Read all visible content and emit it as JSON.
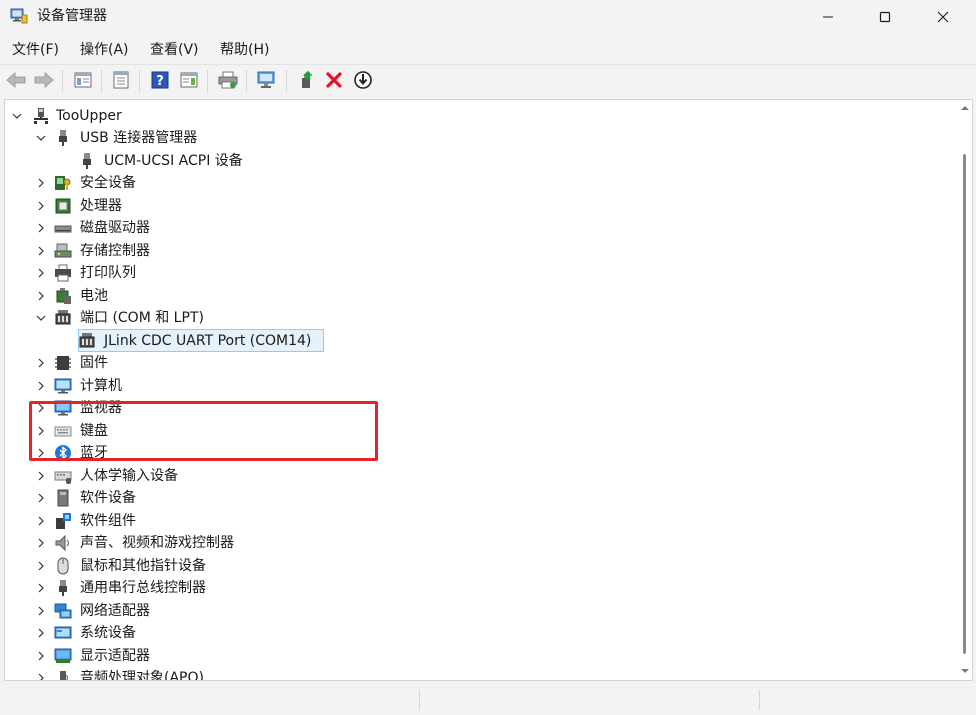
{
  "window": {
    "title": "设备管理器",
    "icon": "device-manager-icon",
    "controls": [
      "minimize-icon",
      "maximize-icon",
      "close-icon"
    ]
  },
  "menu": [
    {
      "label": "文件(F)"
    },
    {
      "label": "操作(A)"
    },
    {
      "label": "查看(V)"
    },
    {
      "label": "帮助(H)"
    }
  ],
  "toolbar": [
    {
      "icon": "back-arrow-icon"
    },
    {
      "icon": "forward-arrow-icon"
    },
    {
      "icon": "show-hide-console-tree-icon"
    },
    {
      "icon": "properties-icon"
    },
    {
      "icon": "help-icon"
    },
    {
      "icon": "action-pane-icon"
    },
    {
      "icon": "print-icon"
    },
    {
      "icon": "scan-hardware-icon"
    },
    {
      "icon": "update-driver-icon"
    },
    {
      "icon": "uninstall-device-icon"
    },
    {
      "icon": "disable-device-icon"
    }
  ],
  "tree": {
    "root": {
      "label": "TooUpper",
      "expanded": true,
      "icon": "computer-icon"
    },
    "items": [
      {
        "label": "USB 连接器管理器",
        "expanded": true,
        "level": 1,
        "icon": "usb-connector-icon"
      },
      {
        "label": "UCM-UCSI ACPI 设备",
        "level": 2,
        "icon": "usb-connector-icon"
      },
      {
        "label": "安全设备",
        "expanded": false,
        "level": 1,
        "icon": "security-device-icon"
      },
      {
        "label": "处理器",
        "expanded": false,
        "level": 1,
        "icon": "processor-icon"
      },
      {
        "label": "磁盘驱动器",
        "expanded": false,
        "level": 1,
        "icon": "disk-drive-icon"
      },
      {
        "label": "存储控制器",
        "expanded": false,
        "level": 1,
        "icon": "storage-controller-icon"
      },
      {
        "label": "打印队列",
        "expanded": false,
        "level": 1,
        "icon": "printer-icon"
      },
      {
        "label": "电池",
        "expanded": false,
        "level": 1,
        "icon": "battery-icon"
      },
      {
        "label": "端口 (COM 和 LPT)",
        "expanded": true,
        "level": 1,
        "icon": "port-icon"
      },
      {
        "label": "JLink CDC UART Port (COM14)",
        "level": 2,
        "icon": "port-icon",
        "selected": true
      },
      {
        "label": "固件",
        "expanded": false,
        "level": 1,
        "icon": "firmware-icon"
      },
      {
        "label": "计算机",
        "expanded": false,
        "level": 1,
        "icon": "computer-monitor-icon"
      },
      {
        "label": "监视器",
        "expanded": false,
        "level": 1,
        "icon": "monitor-icon"
      },
      {
        "label": "键盘",
        "expanded": false,
        "level": 1,
        "icon": "keyboard-icon"
      },
      {
        "label": "蓝牙",
        "expanded": false,
        "level": 1,
        "icon": "bluetooth-icon"
      },
      {
        "label": "人体学输入设备",
        "expanded": false,
        "level": 1,
        "icon": "hid-icon"
      },
      {
        "label": "软件设备",
        "expanded": false,
        "level": 1,
        "icon": "software-device-icon"
      },
      {
        "label": "软件组件",
        "expanded": false,
        "level": 1,
        "icon": "software-component-icon"
      },
      {
        "label": "声音、视频和游戏控制器",
        "expanded": false,
        "level": 1,
        "icon": "speaker-icon"
      },
      {
        "label": "鼠标和其他指针设备",
        "expanded": false,
        "level": 1,
        "icon": "mouse-icon"
      },
      {
        "label": "通用串行总线控制器",
        "expanded": false,
        "level": 1,
        "icon": "usb-controller-icon"
      },
      {
        "label": "网络适配器",
        "expanded": false,
        "level": 1,
        "icon": "network-adapter-icon"
      },
      {
        "label": "系统设备",
        "expanded": false,
        "level": 1,
        "icon": "system-device-icon"
      },
      {
        "label": "显示适配器",
        "expanded": false,
        "level": 1,
        "icon": "display-adapter-icon"
      },
      {
        "label": "音频处理对象(APO)",
        "expanded": false,
        "level": 1,
        "icon": "audio-processing-icon"
      }
    ]
  },
  "colors": {
    "highlight_border": "#e5232b",
    "selection_fill": "#e5f1fb",
    "selection_border": "#99c9ef",
    "uninstall_red": "#e81123",
    "update_green": "#1e9e3a"
  }
}
